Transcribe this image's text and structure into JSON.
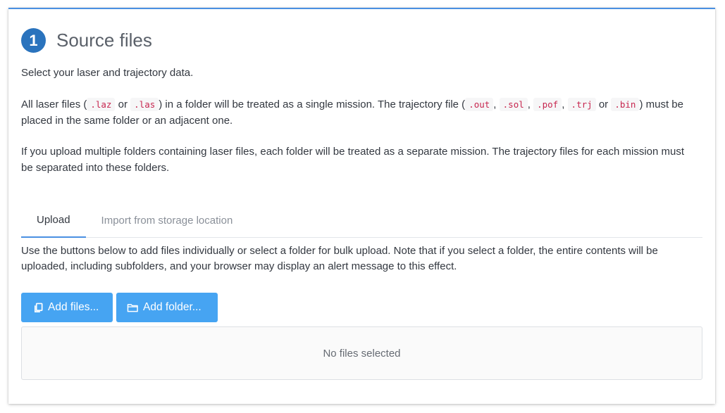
{
  "section": {
    "step_number": "1",
    "title": "Source files"
  },
  "intro": {
    "line1": "Select your laser and trajectory data.",
    "p2_part1": "All laser files (",
    "p2_laz": ".laz",
    "p2_or1": " or ",
    "p2_las": ".las",
    "p2_part2": ") in a folder will be treated as a single mission. The trajectory file (",
    "p2_out": ".out",
    "p2_comma1": ", ",
    "p2_sol": ".sol",
    "p2_comma2": ", ",
    "p2_pof": ".pof",
    "p2_comma3": ", ",
    "p2_trj": ".trj",
    "p2_or2": " or ",
    "p2_bin": ".bin",
    "p2_part3": ") must be placed in the same folder or an adjacent one.",
    "p3": "If you upload multiple folders containing laser files, each folder will be treated as a separate mission. The trajectory files for each mission must be separated into these folders."
  },
  "tabs": [
    {
      "label": "Upload",
      "active": true
    },
    {
      "label": "Import from storage location",
      "active": false
    }
  ],
  "upload": {
    "description": "Use the buttons below to add files individually or select a folder for bulk upload. Note that if you select a folder, the entire contents will be uploaded, including subfolders, and your browser may display an alert message to this effect.",
    "add_files_label": "Add files...",
    "add_folder_label": "Add folder...",
    "empty_text": "No files selected"
  },
  "colors": {
    "accent": "#4a90e2",
    "badge": "#2a73bd",
    "button": "#46a4f2",
    "code_text": "#c7254e"
  },
  "icons": {
    "files": "copy-files-icon",
    "folder": "folder-icon"
  }
}
